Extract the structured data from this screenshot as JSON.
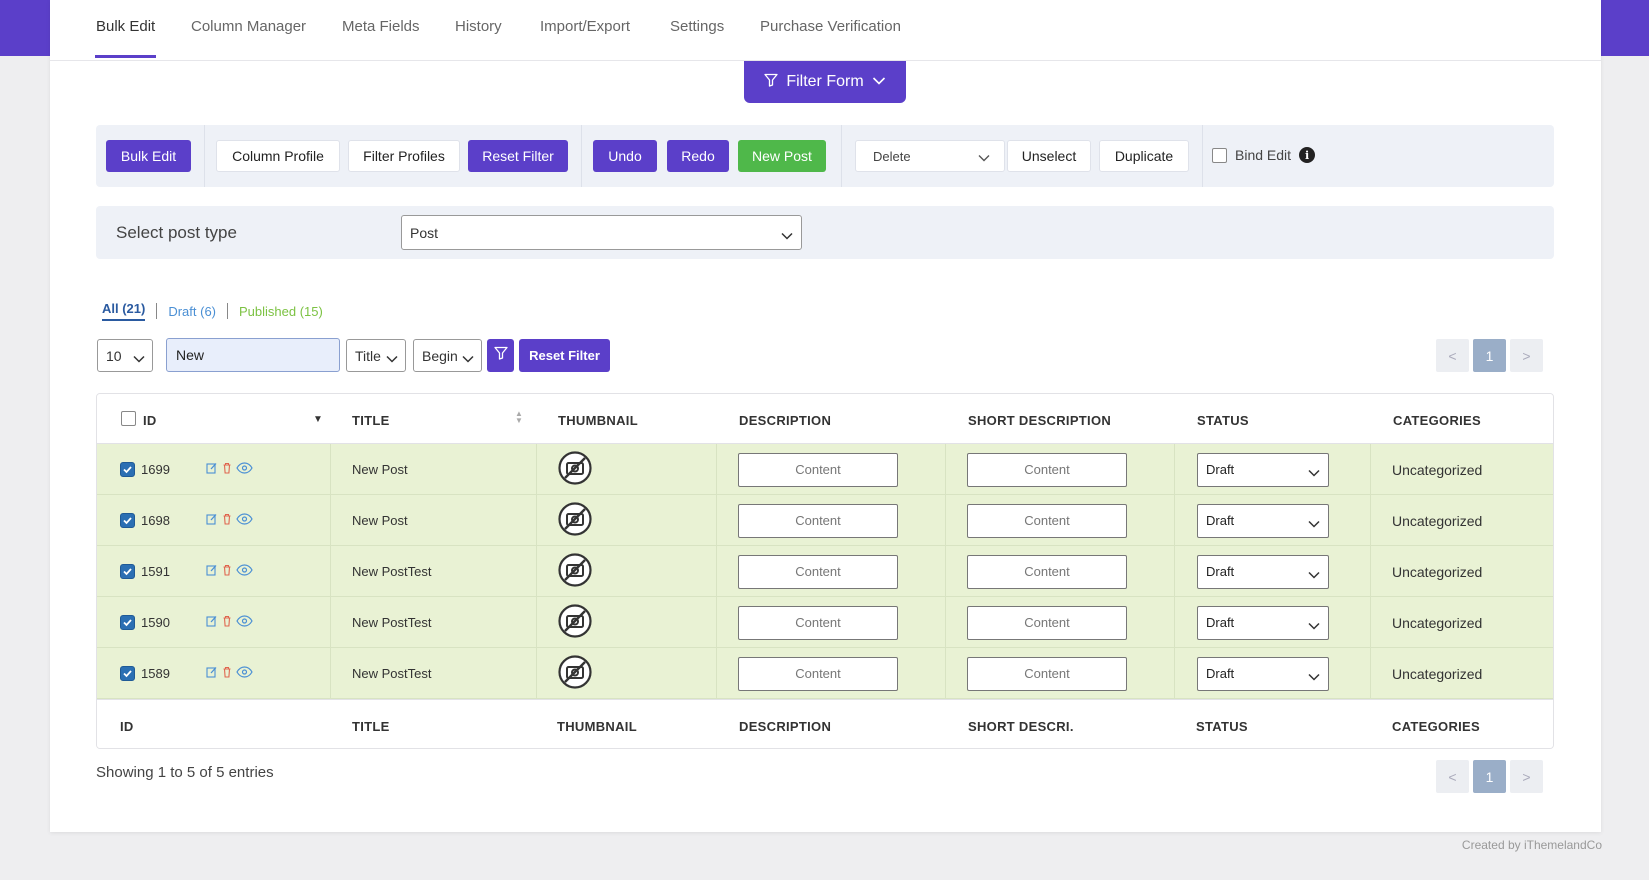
{
  "tabs": [
    "Bulk Edit",
    "Column Manager",
    "Meta Fields",
    "History",
    "Import/Export",
    "Settings",
    "Purchase Verification"
  ],
  "active_tab": "Bulk Edit",
  "filter_form": {
    "label": "Filter Form"
  },
  "toolbar": {
    "bulk_edit": "Bulk Edit",
    "column_profile": "Column Profile",
    "filter_profiles": "Filter Profiles",
    "reset_filter": "Reset Filter",
    "undo": "Undo",
    "redo": "Redo",
    "new_post": "New Post",
    "delete_select": "Delete",
    "unselect": "Unselect",
    "duplicate": "Duplicate",
    "bind_edit": "Bind Edit"
  },
  "post_type": {
    "label": "Select post type",
    "value": "Post"
  },
  "status_links": {
    "all": "All (21)",
    "draft": "Draft (6)",
    "published": "Published (15)"
  },
  "search": {
    "per_page": "10",
    "query": "New",
    "field": "Title",
    "match": "Begin",
    "reset_label": "Reset Filter"
  },
  "pager": {
    "prev": "<",
    "current": "1",
    "next": ">"
  },
  "table": {
    "headers": {
      "id": "ID",
      "title": "TITLE",
      "thumbnail": "THUMBNAIL",
      "description": "DESCRIPTION",
      "short_description": "SHORT DESCRIPTION",
      "status": "STATUS",
      "categories": "CATEGORIES"
    },
    "footers": {
      "id": "ID",
      "title": "TITLE",
      "thumbnail": "THUMBNAIL",
      "description": "DESCRIPTION",
      "short_description": "SHORT DESCRI.",
      "status": "STATUS",
      "categories": "CATEGORIES"
    },
    "rows": [
      {
        "id": "1699",
        "title": "New Post",
        "description": "Content",
        "short_description": "Content",
        "status": "Draft",
        "categories": "Uncategorized",
        "checked": true
      },
      {
        "id": "1698",
        "title": "New Post",
        "description": "Content",
        "short_description": "Content",
        "status": "Draft",
        "categories": "Uncategorized",
        "checked": true
      },
      {
        "id": "1591",
        "title": "New PostTest",
        "description": "Content",
        "short_description": "Content",
        "status": "Draft",
        "categories": "Uncategorized",
        "checked": true
      },
      {
        "id": "1590",
        "title": "New PostTest",
        "description": "Content",
        "short_description": "Content",
        "status": "Draft",
        "categories": "Uncategorized",
        "checked": true
      },
      {
        "id": "1589",
        "title": "New PostTest",
        "description": "Content",
        "short_description": "Content",
        "status": "Draft",
        "categories": "Uncategorized",
        "checked": true
      }
    ]
  },
  "showing": "Showing 1 to 5 of 5 entries",
  "credit": "Created by iThemelandCo",
  "colors": {
    "primary": "#5b3fc9",
    "green": "#4fb84a",
    "row_bg": "#e9f2d4",
    "link_draft": "#4a8fd4",
    "link_published": "#7cc243"
  },
  "icons": [
    "filter-icon",
    "chevron-down-icon",
    "info-icon",
    "edit-icon",
    "trash-icon",
    "eye-icon",
    "no-image-icon",
    "sort-icon"
  ]
}
